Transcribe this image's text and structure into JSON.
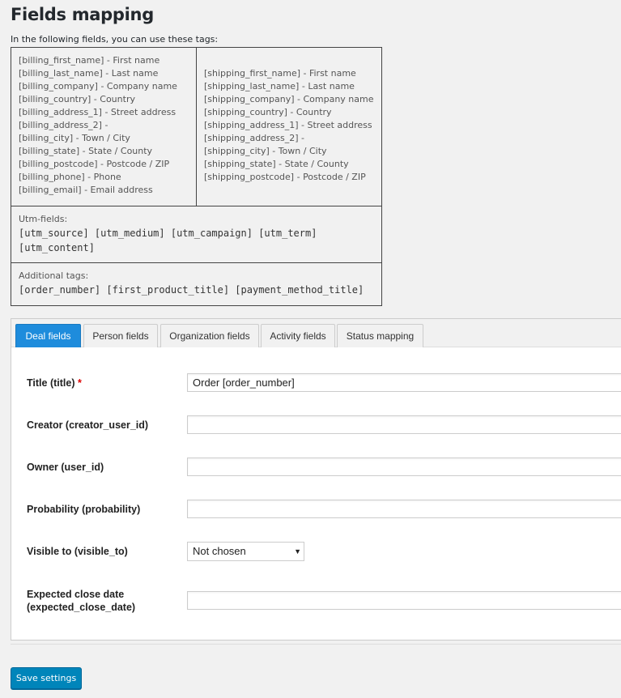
{
  "page": {
    "title": "Fields mapping",
    "intro": "In the following fields, you can use these tags:"
  },
  "tags": {
    "billing": [
      "[billing_first_name] - First name",
      "[billing_last_name] - Last name",
      "[billing_company] - Company name",
      "[billing_country] - Country",
      "[billing_address_1] - Street address",
      "[billing_address_2] -",
      "[billing_city] - Town / City",
      "[billing_state] - State / County",
      "[billing_postcode] - Postcode / ZIP",
      "[billing_phone] - Phone",
      "[billing_email] - Email address"
    ],
    "shipping": [
      "[shipping_first_name] - First name",
      "[shipping_last_name] - Last name",
      "[shipping_company] - Company name",
      "[shipping_country] - Country",
      "[shipping_address_1] - Street address",
      "[shipping_address_2] -",
      "[shipping_city] - Town / City",
      "[shipping_state] - State / County",
      "[shipping_postcode] - Postcode / ZIP"
    ],
    "utm_label": "Utm-fields:",
    "utm_line1": "[utm_source] [utm_medium] [utm_campaign] [utm_term]",
    "utm_line2": "[utm_content]",
    "additional_label": "Additional tags:",
    "additional_line": "[order_number] [first_product_title] [payment_method_title]"
  },
  "tabs": [
    {
      "label": "Deal fields",
      "active": true
    },
    {
      "label": "Person fields",
      "active": false
    },
    {
      "label": "Organization fields",
      "active": false
    },
    {
      "label": "Activity fields",
      "active": false
    },
    {
      "label": "Status mapping",
      "active": false
    }
  ],
  "fields": {
    "title": {
      "label": "Title (title)",
      "required_mark": "*",
      "value": "Order [order_number]"
    },
    "creator": {
      "label": "Creator (creator_user_id)",
      "value": ""
    },
    "owner": {
      "label": "Owner (user_id)",
      "value": ""
    },
    "probability": {
      "label": "Probability (probability)",
      "value": ""
    },
    "visible_to": {
      "label": "Visible to (visible_to)",
      "selected": "Not chosen"
    },
    "expected_close_date": {
      "label_line1": "Expected close date",
      "label_line2": "(expected_close_date)",
      "value": ""
    }
  },
  "actions": {
    "save_label": "Save settings"
  },
  "colors": {
    "accent": "#0085ba",
    "active_tab": "#1e8cdc",
    "required": "#dd0000"
  }
}
